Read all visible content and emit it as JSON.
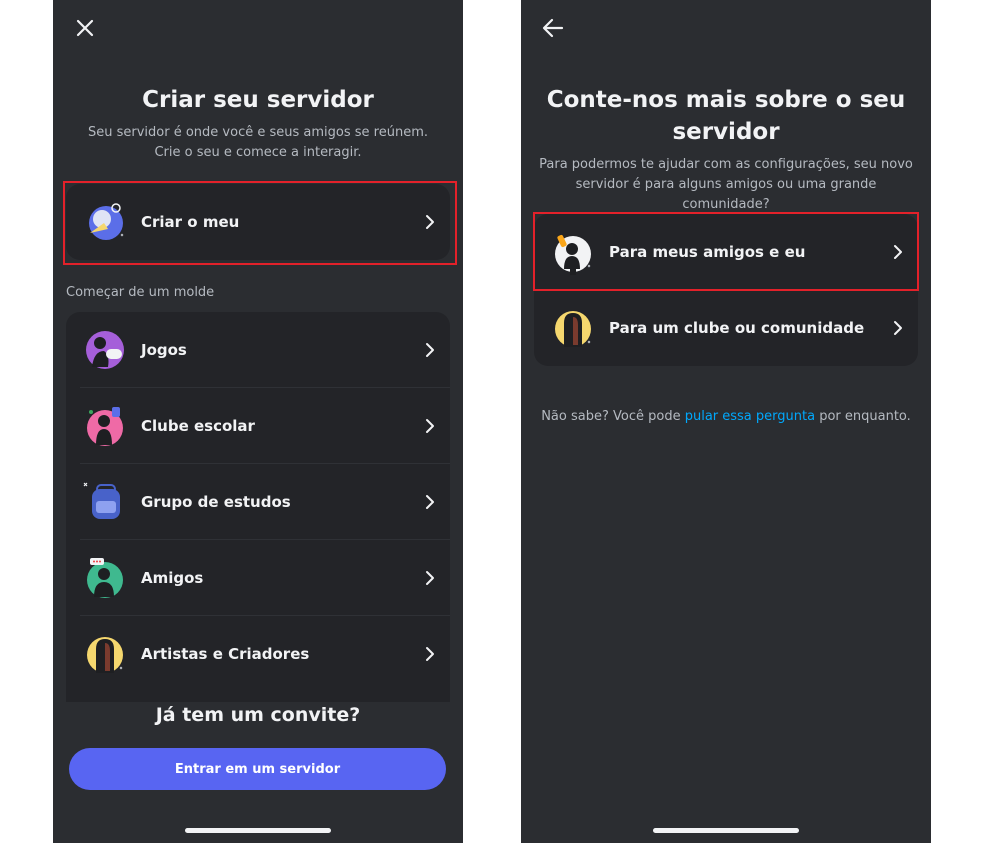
{
  "left": {
    "title": "Criar seu servidor",
    "subtitle_line1": "Seu servidor é onde você e seus amigos se reúnem.",
    "subtitle_line2": "Crie o seu e comece a interagir.",
    "create_own_label": "Criar o meu",
    "template_section_label": "Começar de um molde",
    "templates": [
      {
        "label": "Jogos",
        "icon": "gaming-icon"
      },
      {
        "label": "Clube escolar",
        "icon": "school-club-icon"
      },
      {
        "label": "Grupo de estudos",
        "icon": "study-group-icon"
      },
      {
        "label": "Amigos",
        "icon": "friends-icon"
      },
      {
        "label": "Artistas e Criadores",
        "icon": "artists-icon"
      }
    ],
    "invite_title": "Já tem um convite?",
    "join_button_label": "Entrar em um servidor",
    "close_icon": "close-icon"
  },
  "right": {
    "title_line1": "Conte-nos mais sobre o seu",
    "title_line2": "servidor",
    "subtitle_line1": "Para podermos te ajudar com as configurações, seu novo",
    "subtitle_line2": "servidor é para alguns amigos ou uma grande comunidade?",
    "options": [
      {
        "label": "Para meus amigos e eu",
        "icon": "friends-and-me-icon"
      },
      {
        "label": "Para um clube ou comunidade",
        "icon": "club-community-icon"
      }
    ],
    "note_prefix": "Não sabe? Você pode ",
    "note_link": "pular essa pergunta",
    "note_suffix": " por enquanto.",
    "back_icon": "back-arrow-icon"
  },
  "colors": {
    "background": "#2b2d31",
    "card": "#232428",
    "accent": "#5865f2",
    "link": "#00a8fc",
    "highlight": "#e3212a",
    "text_primary": "#f2f3f5",
    "text_secondary": "#b5bac1"
  }
}
